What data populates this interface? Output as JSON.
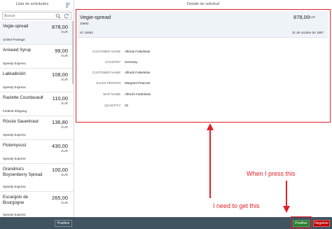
{
  "master": {
    "title": "Lista de solicitudes",
    "search_placeholder": "Buscar",
    "items": [
      {
        "name": "Vegie-spread",
        "price": "878,00",
        "currency": "EUR",
        "sub": "United Package",
        "selected": true
      },
      {
        "name": "Aniseed Syrup",
        "price": "99,00",
        "currency": "EUR",
        "sub": "Speedy Express"
      },
      {
        "name": "Lakkaliköōri",
        "price": "108,00",
        "currency": "EUR",
        "sub": "Speedy Express"
      },
      {
        "name": "Raclette Courdavault",
        "price": "110,00",
        "currency": "EUR",
        "sub": "Federal Shipping"
      },
      {
        "name": "Rössle Sauerkraut",
        "price": "136,80",
        "currency": "EUR",
        "sub": "Speedy Express"
      },
      {
        "name": "Flotemysost",
        "price": "430,00",
        "currency": "EUR",
        "sub": "Speedy Express"
      },
      {
        "name": "Grandma's Boysenberry Spread",
        "price": "100,00",
        "currency": "EUR",
        "sub": "Speedy Express"
      },
      {
        "name": "Escargots de Bourgogne",
        "price": "265,00",
        "currency": "EUR",
        "sub": "Speedy Express"
      }
    ],
    "positive_label": "Positive"
  },
  "detail": {
    "title": "Detalle de solicitud",
    "name": "Vegie-spread",
    "number": "10692",
    "price": "878,00",
    "currency": "EUR",
    "id_text": "Id: 10692",
    "date": "31 de octubre de 1997",
    "fields": [
      {
        "label": "CUSTOMER NAME:",
        "value": "Alfreds Futterkiste"
      },
      {
        "label": "COUNTRY:",
        "value": "Germany"
      },
      {
        "label": "CUSTOMER NAME:",
        "value": "Alfreds Futterkiste"
      },
      {
        "label": "SALES PERSON:",
        "value": "Margaret Peacock"
      },
      {
        "label": "SHIP NAME:",
        "value": "Alfred's Futterkiste"
      },
      {
        "label": "QUANTITY:",
        "value": "20"
      }
    ],
    "positive_label": "Positive",
    "negative_label": "Negative"
  },
  "annotations": {
    "press": "When I press this",
    "get": "I need to get this",
    "color": "#e0202a"
  },
  "colors": {
    "footer": "#3f5360",
    "positive": "#2b7c2b",
    "negative": "#bb0000",
    "selected_bg": "#f1f5fa"
  }
}
